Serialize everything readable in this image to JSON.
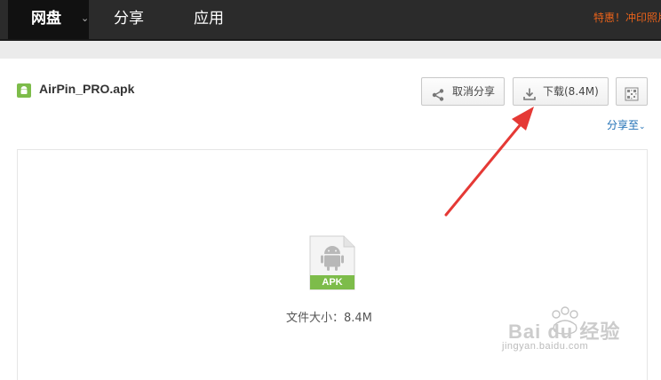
{
  "nav": {
    "active": "网盘",
    "share": "分享",
    "apps": "应用",
    "promo": "特惠！冲印照片"
  },
  "file": {
    "name": "AirPin_PRO.apk",
    "type_label": "APK",
    "size_text": "文件大小：8.4M"
  },
  "toolbar": {
    "unshare_label": "取消分享",
    "download_label": "下载(8.4M)",
    "share_to_label": "分享至"
  },
  "colors": {
    "nav_bg": "#2b2b2b",
    "nav_active_bg": "#111111",
    "promo": "#e8621a",
    "link": "#1f6fb5",
    "apk_green": "#7dbc4a",
    "arrow_red": "#e53935"
  },
  "icons": {
    "unshare": "share-icon",
    "download": "download-icon",
    "qr": "qrcode-icon",
    "file": "android-icon"
  },
  "watermark": {
    "brand": "Bai du 经验",
    "url": "jingyan.baidu.com"
  }
}
